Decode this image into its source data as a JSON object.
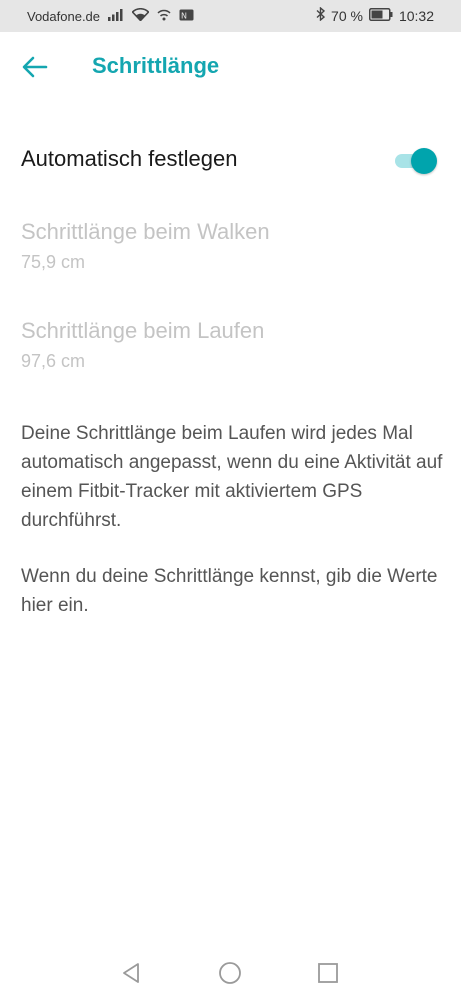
{
  "status_bar": {
    "carrier": "Vodafone.de",
    "battery_percent": "70 %",
    "time": "10:32",
    "icons": [
      "signal-icon",
      "wifi-icon",
      "wifi-call-icon",
      "nfc-icon",
      "bluetooth-icon",
      "battery-icon"
    ]
  },
  "app_bar": {
    "back_icon": "arrow-left-icon",
    "title": "Schrittlänge"
  },
  "auto_setting": {
    "label": "Automatisch festlegen",
    "enabled": true
  },
  "walking": {
    "label": "Schrittlänge beim Walken",
    "value": "75,9 cm"
  },
  "running": {
    "label": "Schrittlänge beim Laufen",
    "value": "97,6 cm"
  },
  "info": {
    "paragraph1": "Deine Schrittlänge beim Laufen wird jedes Mal automatisch angepasst, wenn du eine Aktivität auf einem Fitbit-Tracker mit aktiviertem GPS durchführst.",
    "paragraph2": "Wenn du deine Schrittlänge kennst, gib die Werte hier ein."
  },
  "nav_bar": {
    "icons": [
      "back-triangle-icon",
      "home-circle-icon",
      "recents-square-icon"
    ]
  },
  "colors": {
    "accent": "#14a6b0",
    "toggle_thumb": "#00a4ad",
    "toggle_track": "#a8e3e7",
    "disabled_text": "#c4c4c4",
    "body_text": "#555555",
    "status_bar_bg": "#e6e6e6"
  }
}
